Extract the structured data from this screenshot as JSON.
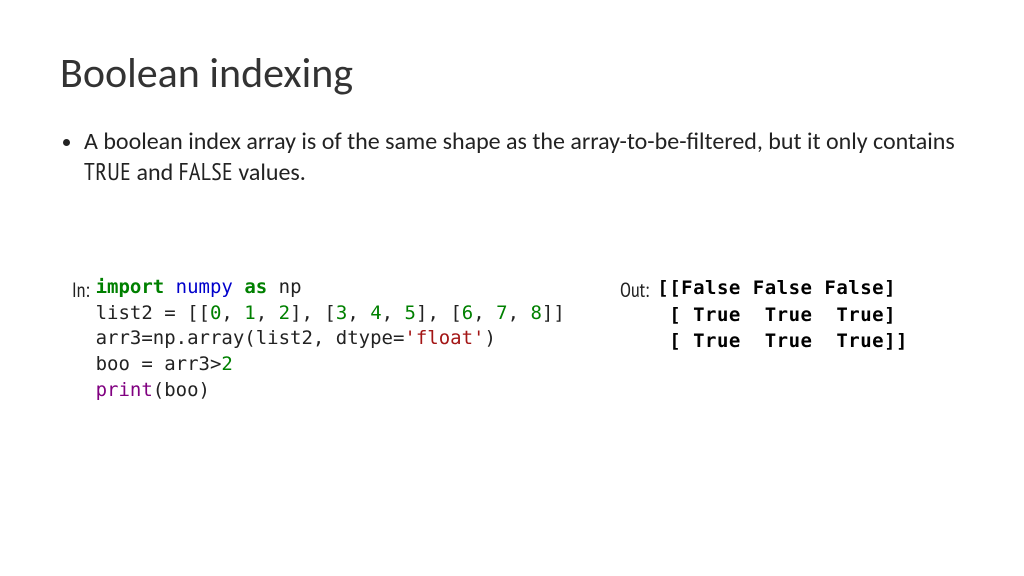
{
  "title": "Boolean indexing",
  "bullet_prefix": "A boolean index array is of the same shape as the array-to-be-filtered, but it only contains ",
  "true_word": "TRUE",
  "bullet_mid": " and ",
  "false_word": "FALSE",
  "bullet_suffix": " values.",
  "in_label": "In:",
  "out_label": "Out:",
  "code": {
    "l1_import": "import",
    "l1_numpy": "numpy",
    "l1_as": "as",
    "l1_np": "np",
    "l2_a": "list2 = [[",
    "l2_n0": "0",
    "l2_c1": ", ",
    "l2_n1": "1",
    "l2_c2": ", ",
    "l2_n2": "2",
    "l2_b": "], [",
    "l2_n3": "3",
    "l2_c3": ", ",
    "l2_n4": "4",
    "l2_c4": ", ",
    "l2_n5": "5",
    "l2_c": "], [",
    "l2_n6": "6",
    "l2_c5": ", ",
    "l2_n7": "7",
    "l2_c6": ", ",
    "l2_n8": "8",
    "l2_d": "]]",
    "l3_a": "arr3=np.array(list2, dtype=",
    "l3_str": "'float'",
    "l3_b": ")",
    "l4": "boo = arr3>",
    "l4_n": "2",
    "l5_print": "print",
    "l5_b": "(boo)"
  },
  "output_lines": [
    "[[False False False]",
    " [ True  True  True]",
    " [ True  True  True]]"
  ]
}
